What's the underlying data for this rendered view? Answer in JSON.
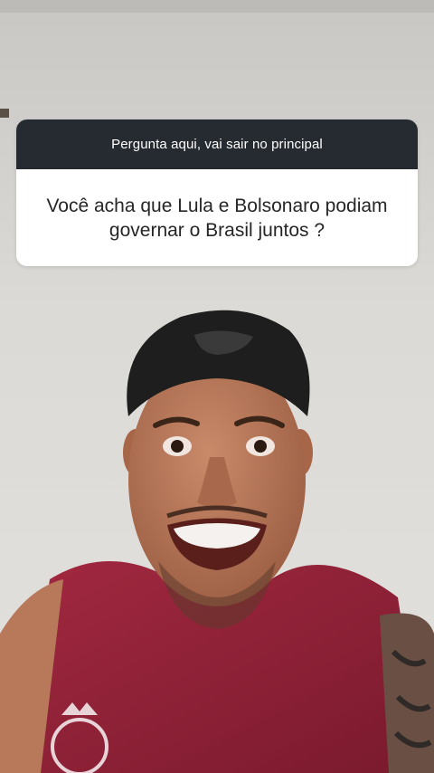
{
  "question_sticker": {
    "prompt": "Pergunta aqui, vai sair no principal",
    "question": "Você acha que Lula e Bolsonaro podiam\ngovernar o Brasil juntos ?"
  },
  "colors": {
    "header_bg": "#262a31",
    "card_bg": "#ffffff",
    "wall": "#d9d7d3",
    "shirt": "#8e1f35",
    "cap": "#1d1d1d",
    "skin": "#b9785a"
  }
}
